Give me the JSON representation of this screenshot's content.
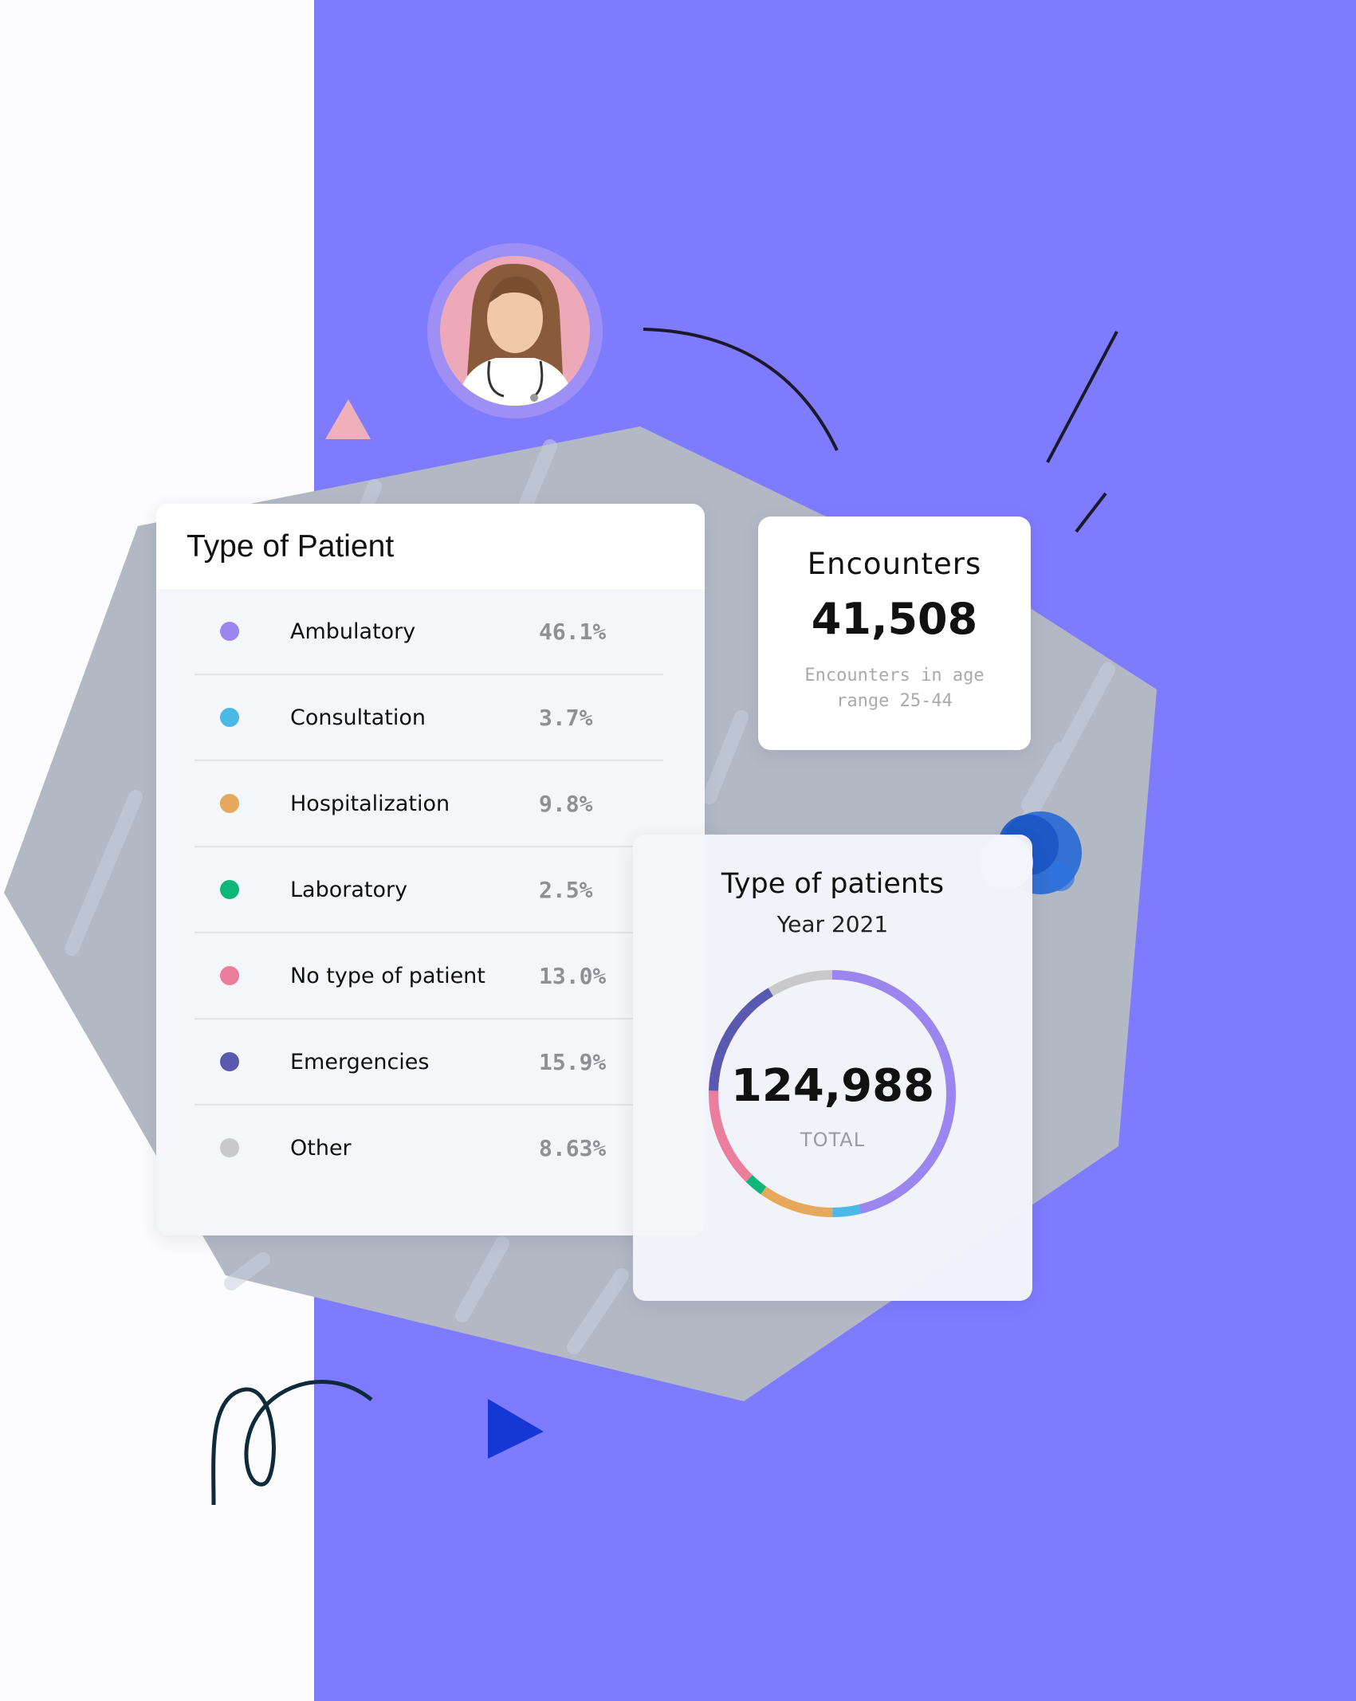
{
  "patient_card": {
    "title": "Type of Patient",
    "rows": [
      {
        "label": "Ambulatory",
        "value": "46.1%",
        "color": "#9b86ef"
      },
      {
        "label": "Consultation",
        "value": "3.7%",
        "color": "#4cb8e8"
      },
      {
        "label": "Hospitalization",
        "value": "9.8%",
        "color": "#e6a95c"
      },
      {
        "label": "Laboratory",
        "value": "2.5%",
        "color": "#0db77a"
      },
      {
        "label": "No type of patient",
        "value": "13.0%",
        "color": "#eb7e9c"
      },
      {
        "label": "Emergencies",
        "value": "15.9%",
        "color": "#5b58b0"
      },
      {
        "label": "Other",
        "value": "8.63%",
        "color": "#c9c9cc"
      }
    ]
  },
  "encounters_card": {
    "title": "Encounters",
    "value": "41,508",
    "subtitle": "Encounters in age range 25-44"
  },
  "donut_card": {
    "title": "Type of patients",
    "subtitle": "Year 2021",
    "total": "124,988",
    "total_label": "TOTAL"
  },
  "chart_data": {
    "type": "pie",
    "title": "Type of patients",
    "subtitle": "Year 2021",
    "categories": [
      "Ambulatory",
      "Consultation",
      "Hospitalization",
      "Laboratory",
      "No type of patient",
      "Emergencies",
      "Other"
    ],
    "values": [
      46.1,
      3.7,
      9.8,
      2.5,
      13.0,
      15.9,
      8.63
    ],
    "colors": [
      "#9b86ef",
      "#4cb8e8",
      "#e6a95c",
      "#0db77a",
      "#eb7e9c",
      "#5b58b0",
      "#c9c9cc"
    ],
    "total": 124988
  },
  "colors": {
    "background_accent": "#7f7bff",
    "hexagon": "#b3b9c4",
    "avatar_ring": "#9d8ff5",
    "avatar_bg": "#eda9b8"
  },
  "icons": [
    "doctor-avatar",
    "pink-triangle-icon",
    "blue-play-triangle-icon"
  ]
}
